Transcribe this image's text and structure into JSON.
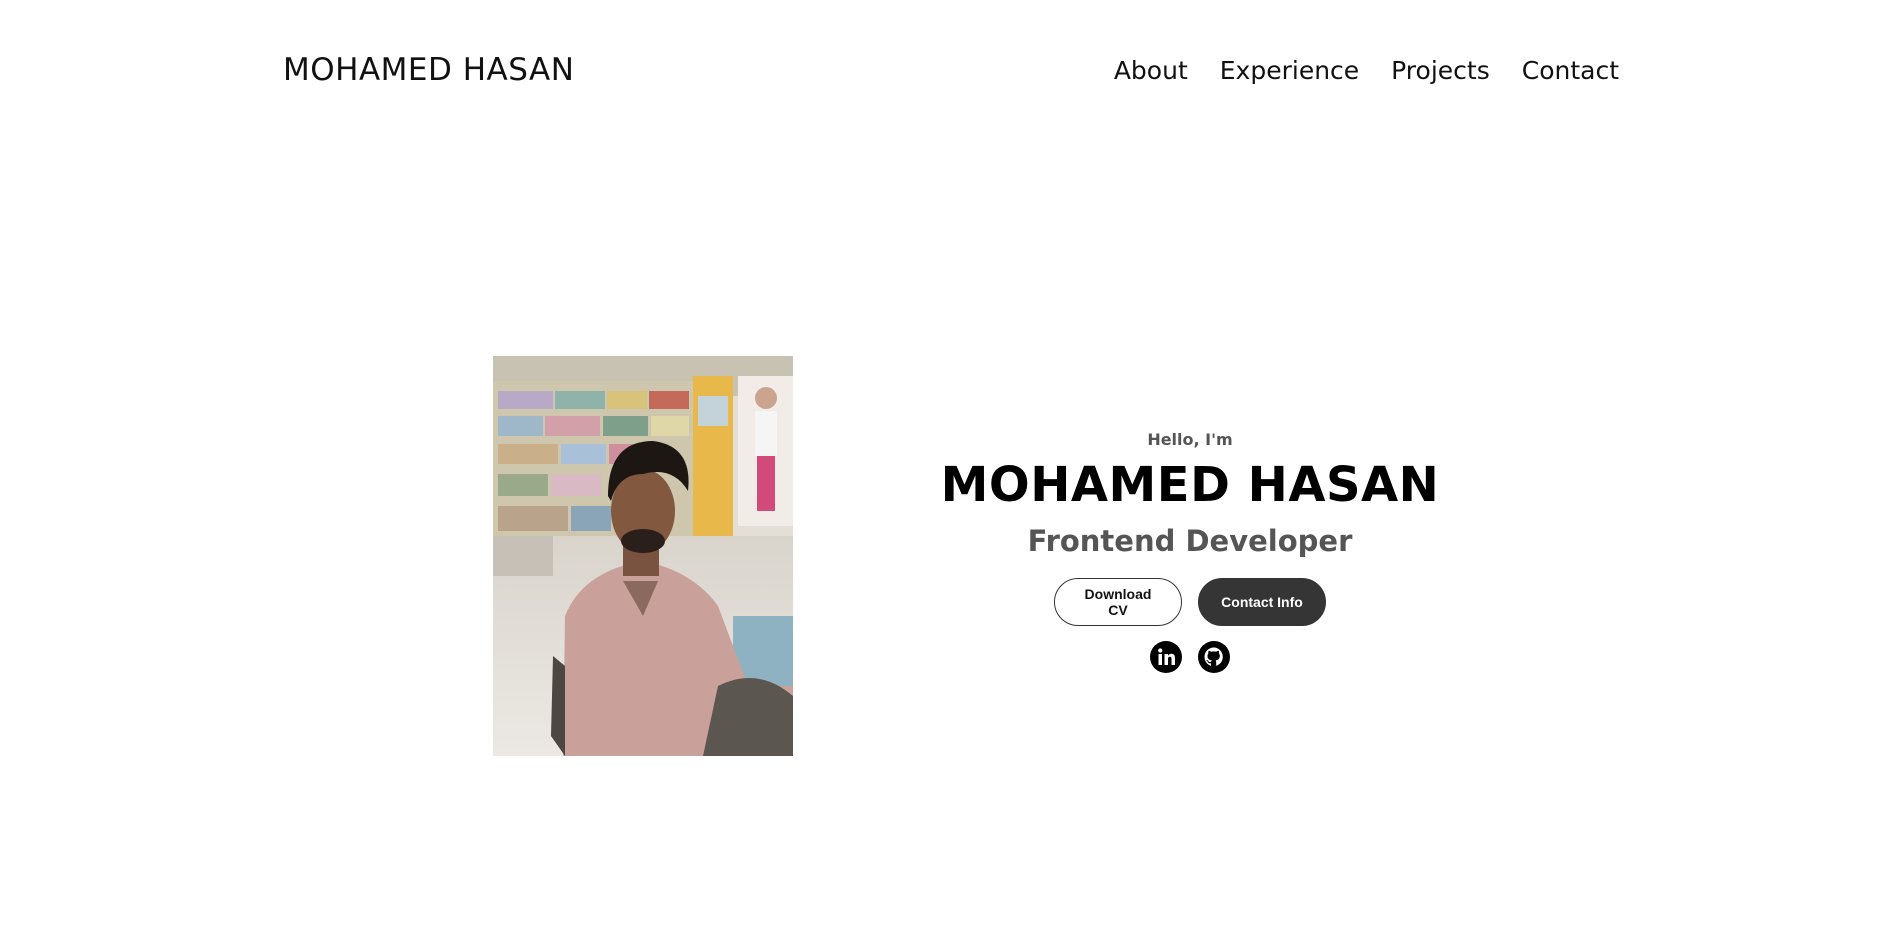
{
  "nav": {
    "logo": "MOHAMED HASAN",
    "links": [
      "About",
      "Experience",
      "Projects",
      "Contact"
    ]
  },
  "hero": {
    "greeting": "Hello, I'm",
    "name": "MOHAMED HASAN",
    "role": "Frontend Developer",
    "download_label": "Download CV",
    "contact_label": "Contact Info"
  },
  "socials": {
    "icons": [
      "linkedin-icon",
      "github-icon"
    ]
  },
  "colors": {
    "dark_button": "#353535",
    "muted_text": "#555555"
  }
}
